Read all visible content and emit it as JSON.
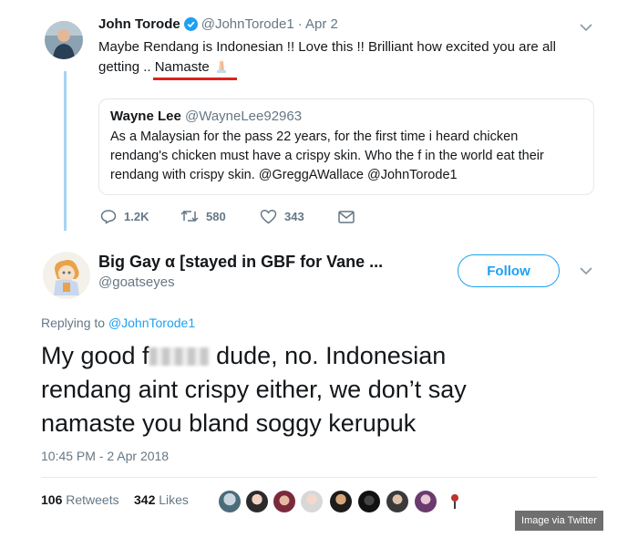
{
  "reply_to_tweet": {
    "author_name": "John Torode",
    "author_handle": "@JohnTorode1",
    "date": "· Apr 2",
    "text_line1": "Maybe Rendang is Indonesian !!   Love this !! Brilliant how excited you are all",
    "text_line2_prefix": "getting .. ",
    "text_line2_highlight": "Namaste",
    "quoted": {
      "author_name": "Wayne Lee",
      "author_handle": "@WayneLee92963",
      "line1": "As a Malaysian for the pass 22 years, for the first time i heard chicken",
      "line2": "rendang's chicken must have a crispy skin. Who the f in the world eat their",
      "line3": "rendang with crispy skin. @GreggAWallace @JohnTorode1"
    },
    "actions": {
      "replies": "1.2K",
      "retweets": "580",
      "likes": "343"
    }
  },
  "main_tweet": {
    "author_name": "Big Gay α [stayed in GBF for Vane ...",
    "author_handle": "@goatseyes",
    "follow_label": "Follow",
    "replying_prefix": "Replying to ",
    "replying_handle": "@JohnTorode1",
    "line1_start": "My good f",
    "line1_end": " dude, no. Indonesian",
    "line2": "rendang aint crispy either, we don’t say",
    "line3": "namaste you bland soggy kerupuk",
    "timestamp": "10:45 PM - 2 Apr 2018",
    "retweets_count": "106",
    "retweets_label": " Retweets",
    "likes_count": "342",
    "likes_label": " Likes"
  },
  "watermark": "Image via Twitter",
  "colors": {
    "accent": "#1da1f2",
    "text": "#14171a",
    "muted": "#657786",
    "underline": "#e0201c",
    "thread": "#a5d4f5"
  }
}
